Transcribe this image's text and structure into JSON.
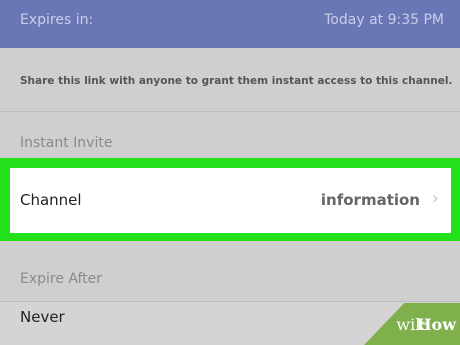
{
  "header": {
    "expires_label": "Expires in:",
    "expires_value": "Today at 9:35 PM"
  },
  "description": "Share this link with anyone to grant them instant access to this channel.",
  "sections": {
    "instant_invite": "Instant Invite",
    "expire_after": "Expire After"
  },
  "channel_row": {
    "label": "Channel",
    "value": "information",
    "icon": "chevron-right-icon"
  },
  "never_row": {
    "label": "Never"
  },
  "watermark": {
    "wiki": "wiki",
    "how": "How"
  },
  "colors": {
    "header_bg": "#6a77b6",
    "highlight": "#22e11a",
    "page_bg": "#cfcfcf"
  }
}
